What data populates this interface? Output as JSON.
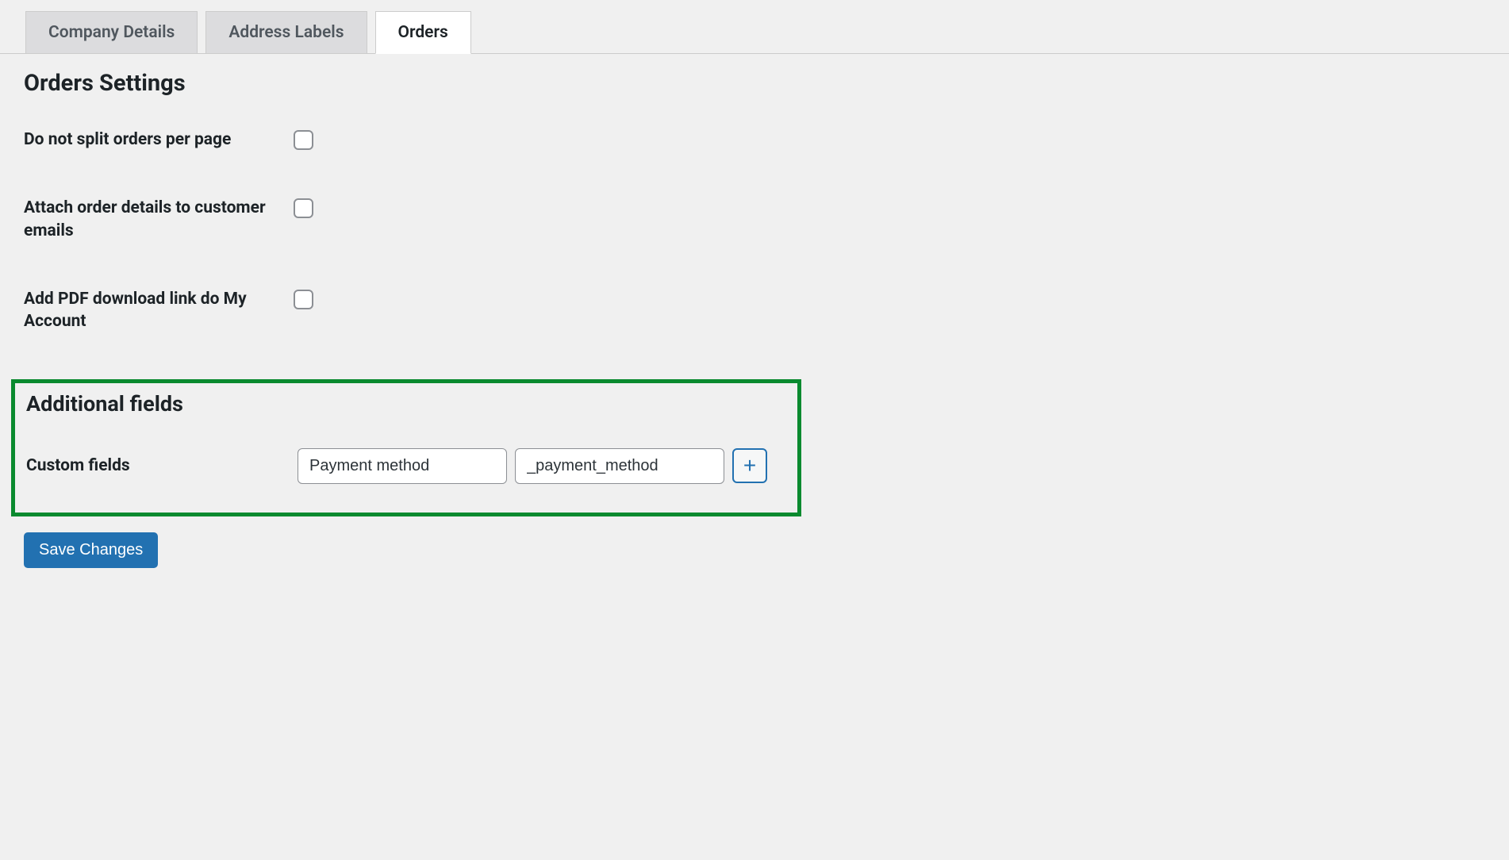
{
  "tabs": [
    {
      "label": "Company Details",
      "active": false
    },
    {
      "label": "Address Labels",
      "active": false
    },
    {
      "label": "Orders",
      "active": true
    }
  ],
  "page_title": "Orders Settings",
  "settings": {
    "split_orders_label": "Do not split orders per page",
    "attach_details_label": "Attach order details to customer emails",
    "pdf_link_label": "Add PDF download link do My Account"
  },
  "additional_fields": {
    "heading": "Additional fields",
    "custom_fields_label": "Custom fields",
    "field_name_value": "Payment method",
    "field_key_value": "_payment_method",
    "add_button_label": "+"
  },
  "save_button_label": "Save Changes"
}
